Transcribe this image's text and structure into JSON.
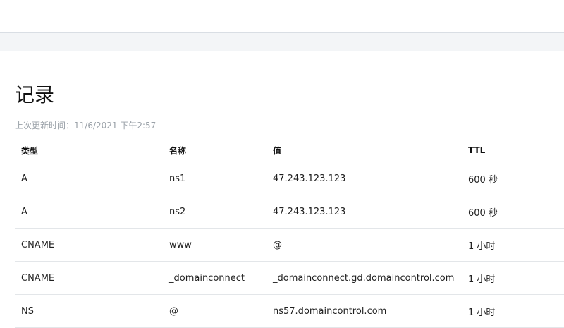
{
  "page": {
    "title": "记录",
    "updated_text": "上次更新时间：11/6/2021 下午2:57"
  },
  "table": {
    "headers": {
      "type": "类型",
      "name": "名称",
      "value": "值",
      "ttl": "TTL"
    },
    "rows": [
      {
        "type": "A",
        "name": "ns1",
        "value": "47.243.123.123",
        "ttl": "600 秒"
      },
      {
        "type": "A",
        "name": "ns2",
        "value": "47.243.123.123",
        "ttl": "600 秒"
      },
      {
        "type": "CNAME",
        "name": "www",
        "value": "@",
        "ttl": "1 小时"
      },
      {
        "type": "CNAME",
        "name": "_domainconnect",
        "value": "_domainconnect.gd.domaincontrol.com",
        "ttl": "1 小时"
      },
      {
        "type": "NS",
        "name": "@",
        "value": "ns57.domaincontrol.com",
        "ttl": "1 小时"
      }
    ]
  }
}
